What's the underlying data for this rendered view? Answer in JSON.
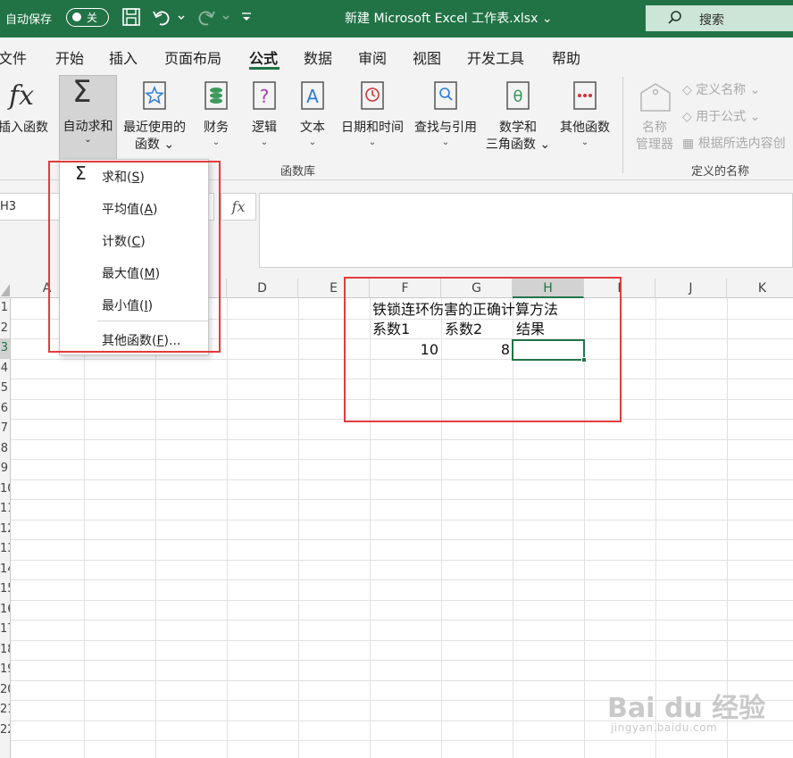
{
  "titlebar": {
    "autosave_label": "自动保存",
    "autosave_state": "关",
    "doc_title": "新建 Microsoft Excel 工作表.xlsx",
    "title_chevron": "⌄",
    "search_label": "搜索",
    "accent_color": "#217346"
  },
  "tabs": [
    "文件",
    "开始",
    "插入",
    "页面布局",
    "公式",
    "数据",
    "审阅",
    "视图",
    "开发工具",
    "帮助"
  ],
  "active_tab": "公式",
  "ribbon": {
    "insert_function": "插入函数",
    "autosum": "自动求和",
    "recently_used_line1": "最近使用的",
    "recently_used_line2": "函数",
    "financial": "财务",
    "logical": "逻辑",
    "text": "文本",
    "date_time": "日期和时间",
    "lookup_ref": "查找与引用",
    "math_trig_line1": "数学和",
    "math_trig_line2": "三角函数",
    "more_functions": "其他函数",
    "function_library_group": "函数库",
    "name_manager_line1": "名称",
    "name_manager_line2": "管理器",
    "define_name": "定义名称",
    "use_in_formula": "用于公式",
    "create_from_selection": "根据所选内容创",
    "defined_names_group": "定义的名称"
  },
  "formula_bar": {
    "name_box": "H3",
    "fx_label": "fx",
    "formula": ""
  },
  "dropdown": {
    "items": [
      {
        "label": "求和(",
        "key": "S",
        "suffix": ")"
      },
      {
        "label": "平均值(",
        "key": "A",
        "suffix": ")"
      },
      {
        "label": "计数(",
        "key": "C",
        "suffix": ")"
      },
      {
        "label": "最大值(",
        "key": "M",
        "suffix": ")"
      },
      {
        "label": "最小值(",
        "key": "I",
        "suffix": ")"
      },
      {
        "label": "其他函数(",
        "key": "F",
        "suffix": ")..."
      }
    ],
    "sum_icon": "Σ"
  },
  "grid": {
    "columns": [
      "A",
      "",
      "",
      "D",
      "E",
      "F",
      "G",
      "H",
      "I",
      "J",
      "K"
    ],
    "selected_column": "H",
    "rows": [
      "1",
      "2",
      "3",
      "4",
      "5",
      "6",
      "7",
      "8",
      "9",
      "10",
      "11",
      "12",
      "13",
      "14",
      "15",
      "16",
      "17",
      "18",
      "19",
      "20",
      "21",
      "22"
    ],
    "selected_row": "3",
    "cells": {
      "F1": "铁锁连环伤害的正确计算方法",
      "F2": "系数1",
      "G2": "系数2",
      "H2": "结果",
      "F3": "10",
      "G3": "8",
      "H3": ""
    }
  },
  "watermark": {
    "main": "Bai du 经验",
    "sub": "jingyan.baidu.com"
  }
}
